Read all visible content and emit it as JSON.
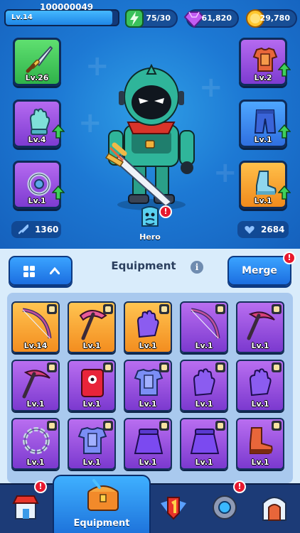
{
  "player": {
    "level_label": "Lv.14",
    "id": "100000049",
    "xp_fraction": 0.95
  },
  "currencies": {
    "energy": "75/30",
    "gems": "61,820",
    "gold": "29,780"
  },
  "equipped": {
    "weapon": {
      "level": "Lv.26",
      "rarity": "green",
      "icon": "sword-icon"
    },
    "gloves": {
      "level": "Lv.4",
      "rarity": "purple",
      "icon": "glove-icon",
      "upgrade": true
    },
    "ring": {
      "level": "Lv.1",
      "rarity": "purple",
      "icon": "ring-icon",
      "upgrade": true
    },
    "armor": {
      "level": "Lv.2",
      "rarity": "purple",
      "icon": "armor-icon",
      "upgrade": true
    },
    "pants": {
      "level": "Lv.1",
      "rarity": "blue",
      "icon": "pants-icon",
      "upgrade": true
    },
    "boots": {
      "level": "Lv.1",
      "rarity": "orange",
      "icon": "boots-icon",
      "upgrade": true
    }
  },
  "stats": {
    "attack": "1360",
    "health": "2684"
  },
  "hero_button": {
    "label": "Hero",
    "badge": "!"
  },
  "panel": {
    "title": "Equipment",
    "merge_label": "Merge",
    "merge_badge": "!"
  },
  "inventory": [
    {
      "level": "Lv.14",
      "rarity": "orange",
      "icon": "bow-icon"
    },
    {
      "level": "Lv.1",
      "rarity": "orange",
      "icon": "pickaxe-icon"
    },
    {
      "level": "Lv.1",
      "rarity": "orange",
      "icon": "glove-icon"
    },
    {
      "level": "Lv.1",
      "rarity": "purple",
      "icon": "bow-icon"
    },
    {
      "level": "Lv.1",
      "rarity": "purple",
      "icon": "scythe-icon"
    },
    {
      "level": "Lv.1",
      "rarity": "purple",
      "icon": "scythe-icon"
    },
    {
      "level": "Lv.1",
      "rarity": "purple",
      "icon": "spellbook-icon"
    },
    {
      "level": "Lv.1",
      "rarity": "purple",
      "icon": "armor-icon"
    },
    {
      "level": "Lv.1",
      "rarity": "purple",
      "icon": "glove-icon"
    },
    {
      "level": "Lv.1",
      "rarity": "purple",
      "icon": "glove-icon"
    },
    {
      "level": "Lv.1",
      "rarity": "purple",
      "icon": "chain-icon"
    },
    {
      "level": "Lv.1",
      "rarity": "purple",
      "icon": "armor-icon"
    },
    {
      "level": "Lv.1",
      "rarity": "purple",
      "icon": "skirt-icon"
    },
    {
      "level": "Lv.1",
      "rarity": "purple",
      "icon": "skirt-icon"
    },
    {
      "level": "Lv.1",
      "rarity": "purple",
      "icon": "boots-icon"
    }
  ],
  "nav": {
    "shop_badge": "!",
    "equipment_label": "Equipment",
    "pet_badge": "!"
  },
  "colors": {
    "purple": "#8a45d8",
    "orange": "#f5a12e",
    "green": "#3cc55a",
    "blue": "#3b86f0",
    "badge": "#e8182e"
  }
}
